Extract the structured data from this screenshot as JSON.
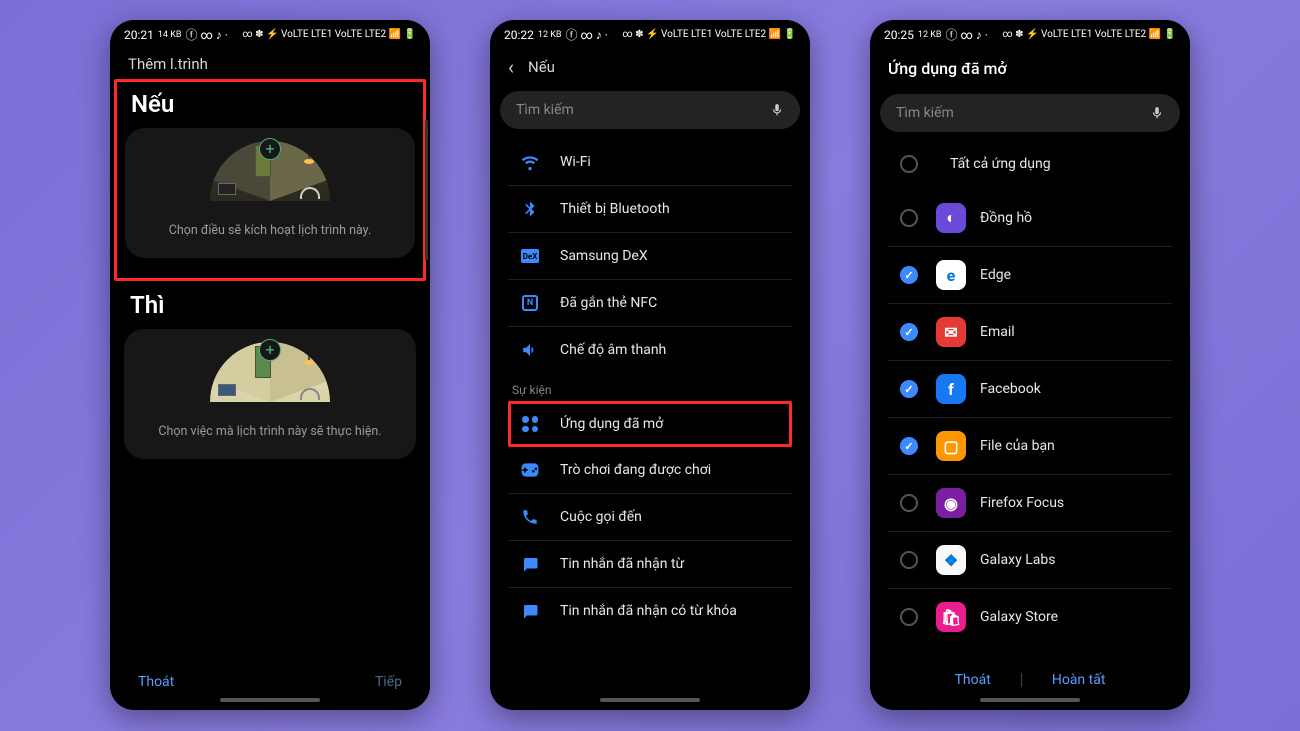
{
  "status": {
    "t1": "20:21",
    "t2": "20:22",
    "t3": "20:25",
    "net": "14 KB",
    "net2": "12 KB",
    "icons_left": "ⓕ ∞ ♪ ·",
    "icons_right": "∞ ✽ ⚡ VoLTE LTE1 VoLTE LTE2 📶 🔋"
  },
  "screen1": {
    "header": "Thêm l.trình",
    "if_title": "Nếu",
    "if_desc": "Chọn điều sẽ kích hoạt lịch trình này.",
    "then_title": "Thì",
    "then_desc": "Chọn việc mà lịch trình này sẽ thực hiện.",
    "exit": "Thoát",
    "next": "Tiếp"
  },
  "screen2": {
    "title": "Nếu",
    "search_placeholder": "Tìm kiếm",
    "items": [
      {
        "icon": "wifi",
        "label": "Wi-Fi"
      },
      {
        "icon": "bluetooth",
        "label": "Thiết bị Bluetooth"
      },
      {
        "icon": "dex",
        "label": "Samsung DeX"
      },
      {
        "icon": "nfc",
        "label": "Đã gắn thẻ NFC"
      },
      {
        "icon": "sound",
        "label": "Chế độ âm thanh"
      }
    ],
    "section2_header": "Sự kiện",
    "items2": [
      {
        "icon": "apps",
        "label": "Ứng dụng đã mở",
        "highlight": true
      },
      {
        "icon": "game",
        "label": "Trò chơi đang được chơi"
      },
      {
        "icon": "call",
        "label": "Cuộc gọi đến"
      },
      {
        "icon": "msg",
        "label": "Tin nhắn đã nhận từ"
      },
      {
        "icon": "msgkw",
        "label": "Tin nhắn đã nhận có từ khóa"
      }
    ]
  },
  "screen3": {
    "title": "Ứng dụng đã mở",
    "search_placeholder": "Tìm kiếm",
    "all_apps": "Tất cả ứng dụng",
    "apps": [
      {
        "name": "Đồng hồ",
        "checked": false,
        "bg": "#6a4ad8",
        "glyph": "◐"
      },
      {
        "name": "Edge",
        "checked": true,
        "bg": "#fff",
        "glyph": "e"
      },
      {
        "name": "Email",
        "checked": true,
        "bg": "#e53935",
        "glyph": "✉"
      },
      {
        "name": "Facebook",
        "checked": true,
        "bg": "#1877f2",
        "glyph": "f"
      },
      {
        "name": "File của bạn",
        "checked": true,
        "bg": "#ff9800",
        "glyph": "▢"
      },
      {
        "name": "Firefox Focus",
        "checked": false,
        "bg": "#7b1fa2",
        "glyph": "◉"
      },
      {
        "name": "Galaxy Labs",
        "checked": false,
        "bg": "#f8f8f8",
        "glyph": "❖"
      },
      {
        "name": "Galaxy Store",
        "checked": false,
        "bg": "#e91e8c",
        "glyph": "🛍"
      }
    ],
    "exit": "Thoát",
    "done": "Hoàn tất"
  }
}
